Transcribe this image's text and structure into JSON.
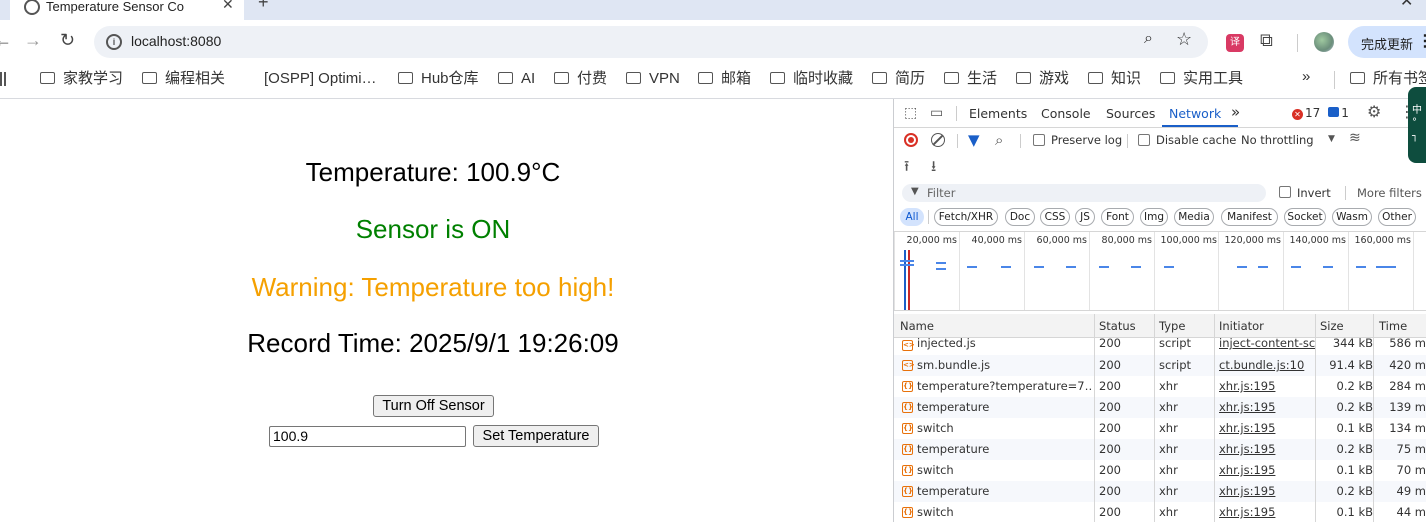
{
  "browser": {
    "tab_title": "Temperature Sensor Co",
    "url": "localhost:8080",
    "update_button": "完成更新",
    "bookmarks": [
      "家教学习",
      "编程相关",
      "[OSPP] Optimi…",
      "Hub仓库",
      "AI",
      "付费",
      "VPN",
      "邮箱",
      "临时收藏",
      "简历",
      "生活",
      "游戏",
      "知识",
      "实用工具"
    ],
    "bookmarks_more": "»",
    "all_bookmarks": "所有书签",
    "extension_label": "译"
  },
  "page": {
    "temperature_text": "Temperature: 100.9°C",
    "sensor_status_text": "Sensor is ON",
    "warning_text": "Warning: Temperature too high!",
    "record_time_text": "Record Time: 2025/9/1 19:26:09",
    "turn_off_button": "Turn Off Sensor",
    "temperature_input_value": "100.9",
    "set_temperature_button": "Set Temperature",
    "colors": {
      "sensor_on": "#008000",
      "warning": "#f5a000"
    }
  },
  "devtools": {
    "tabs": [
      "Elements",
      "Console",
      "Sources",
      "Network"
    ],
    "active_tab": "Network",
    "more_tabs": "»",
    "error_count": "17",
    "message_count": "1",
    "preserve_log": "Preserve log",
    "disable_cache": "Disable cache",
    "throttling": "No throttling",
    "filter_placeholder": "Filter",
    "invert": "Invert",
    "more_filters": "More filters",
    "type_filters": [
      "All",
      "Fetch/XHR",
      "Doc",
      "CSS",
      "JS",
      "Font",
      "Img",
      "Media",
      "Manifest",
      "Socket",
      "Wasm",
      "Other"
    ],
    "active_type_filter": "All",
    "timeline_ticks": [
      "20,000 ms",
      "40,000 ms",
      "60,000 ms",
      "80,000 ms",
      "100,000 ms",
      "120,000 ms",
      "140,000 ms",
      "160,000 ms"
    ],
    "columns": [
      "Name",
      "Status",
      "Type",
      "Initiator",
      "Size",
      "Time"
    ],
    "requests": [
      {
        "name": "injected.js",
        "status": "200",
        "type": "script",
        "initiator": "inject-content-scri",
        "size": "344 kB",
        "time": "586 ms"
      },
      {
        "name": "sm.bundle.js",
        "status": "200",
        "type": "script",
        "initiator": "ct.bundle.js:10",
        "size": "91.4 kB",
        "time": "420 ms"
      },
      {
        "name": "temperature?temperature=7…",
        "status": "200",
        "type": "xhr",
        "initiator": "xhr.js:195",
        "size": "0.2 kB",
        "time": "284 ms"
      },
      {
        "name": "temperature",
        "status": "200",
        "type": "xhr",
        "initiator": "xhr.js:195",
        "size": "0.2 kB",
        "time": "139 ms"
      },
      {
        "name": "switch",
        "status": "200",
        "type": "xhr",
        "initiator": "xhr.js:195",
        "size": "0.1 kB",
        "time": "134 ms"
      },
      {
        "name": "temperature",
        "status": "200",
        "type": "xhr",
        "initiator": "xhr.js:195",
        "size": "0.2 kB",
        "time": "75 ms"
      },
      {
        "name": "switch",
        "status": "200",
        "type": "xhr",
        "initiator": "xhr.js:195",
        "size": "0.1 kB",
        "time": "70 ms"
      },
      {
        "name": "temperature",
        "status": "200",
        "type": "xhr",
        "initiator": "xhr.js:195",
        "size": "0.2 kB",
        "time": "49 ms"
      },
      {
        "name": "switch",
        "status": "200",
        "type": "xhr",
        "initiator": "xhr.js:195",
        "size": "0.1 kB",
        "time": "44 ms"
      }
    ]
  }
}
